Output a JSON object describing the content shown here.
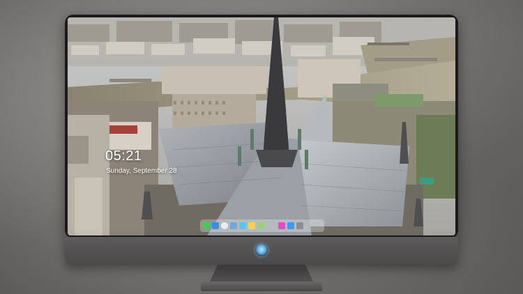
{
  "lock_screen": {
    "time": "05:21",
    "date": "Sunday, September 28"
  },
  "dock": {
    "icons": [
      {
        "name": "messages-icon",
        "color": "#3ecb57"
      },
      {
        "name": "mail-icon",
        "color": "#3a8fe6"
      },
      {
        "name": "safari-icon",
        "color": "#e9eef3"
      },
      {
        "name": "finder-icon",
        "color": "#6fa8dc"
      },
      {
        "name": "video-icon",
        "color": "#56c7e8"
      },
      {
        "name": "notes-icon",
        "color": "#f3d34b"
      },
      {
        "name": "photos-icon",
        "color": "#9ad07a"
      },
      {
        "name": "music-icon",
        "color": "#e74ac2"
      },
      {
        "name": "app-store-icon",
        "color": "#3b9bf0"
      },
      {
        "name": "gallery-icon",
        "color": "#8a8f96"
      }
    ]
  }
}
